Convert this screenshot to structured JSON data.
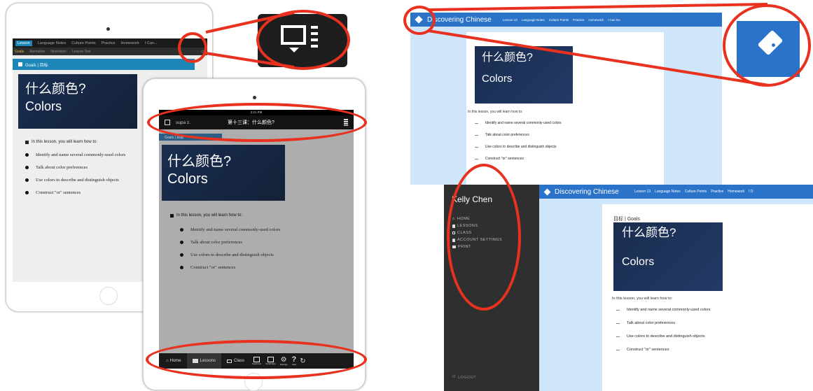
{
  "colors": {
    "highlight": "#e8311e",
    "navy": "#1a2d4f",
    "teal": "#1c86b7",
    "blue_bar": "#2a73c8",
    "dark_side": "#2f2f2f"
  },
  "ipad_a": {
    "tabs": [
      "Lesson",
      "Language Notes",
      "Culture Points",
      "Practice",
      "Homework",
      "I Can..."
    ],
    "subtabs": [
      "Goals",
      "Animation",
      "Illustration",
      "Lesson Text"
    ],
    "goals_label": "Goals | 目标",
    "card_title_zh": "什么颜色?",
    "card_title_en": "Colors",
    "intro": "In this lesson, you will learn how to:",
    "bullets": [
      "Identify and name several commonly-used colors",
      "Talk about color preferences",
      "Use colors to describe and distinguish objects",
      "Construct \"or\" sentences"
    ]
  },
  "ipad_b": {
    "status_time": "3:21 PM",
    "user": "supa z.",
    "header_title": "第十三课：什么颜色?",
    "goals_label": "Goals | 目标",
    "card_title_zh": "什么颜色?",
    "card_title_en": "Colors",
    "intro": "In this lesson, you will learn how to:",
    "bullets": [
      "Identify and name several commonly-used colors",
      "Talk about color preferences",
      "Use colors to describe and distinguish objects",
      "Construct \"or\" sentences"
    ],
    "bottom": {
      "home": "Home",
      "lessons": "Lessons",
      "class": "Class",
      "icon_labels": [
        "Notebook",
        "Vocabulary",
        "Settings",
        "Help"
      ]
    }
  },
  "web_top": {
    "brand": "Discovering Chinese",
    "nav": [
      "Lesson 13",
      "Language Notes",
      "Culture Points",
      "Practice",
      "Homework",
      "I Can Do"
    ],
    "card_title_zh": "什么颜色?",
    "card_title_en": "Colors",
    "intro": "In this lesson, you will learn how to:",
    "bullets": [
      "Identify and name several commonly-used colors",
      "Talk about color preferences",
      "Use colors to describe and distinguish objects",
      "Construct \"or\" sentences"
    ]
  },
  "web_bottom": {
    "user_name": "Kelly Chen",
    "menu": [
      "HOME",
      "LESSONS",
      "CLASS",
      "ACCOUNT SETTINGS",
      "PRINT"
    ],
    "logout": "LOGOUT",
    "brand": "Discovering Chinese",
    "nav": [
      "Lesson 13",
      "Language Notes",
      "Culture Points",
      "Practice",
      "Homework",
      "I D"
    ],
    "goals_label": "目标 | Goals",
    "card_title_zh": "什么颜色?",
    "card_title_en": "Colors",
    "intro": "In this lesson, you will learn how to:",
    "bullets": [
      "Identify and name several commonly-used colors",
      "Talk about color preferences",
      "Use colors to describe and distinguish objects",
      "Construct \"or\" sentences"
    ]
  },
  "icons": {
    "toc": "toc-list-icon",
    "tag": "tag-icon",
    "home": "home-icon",
    "lessons": "book-icon",
    "class": "grid-icon",
    "account": "user-icon",
    "print": "print-icon",
    "logout": "power-icon"
  }
}
